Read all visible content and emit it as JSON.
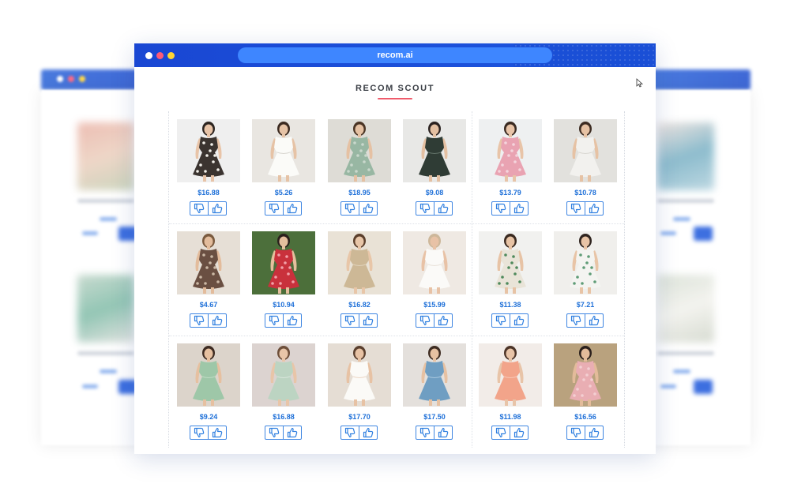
{
  "window": {
    "url": "recom.ai",
    "title": "RECOM SCOUT"
  },
  "products": [
    {
      "price": "$16.88",
      "bg": "#efefef",
      "dress": "#3b3430",
      "skin": "#e8c4a8",
      "hair": "#2c2420",
      "accent": "#f2f0ea",
      "style": "print"
    },
    {
      "price": "$5.26",
      "bg": "#e9e6e1",
      "dress": "#fbfbf8",
      "skin": "#e6c3a6",
      "hair": "#3b2a20",
      "accent": "#d8d6d0",
      "style": "solid"
    },
    {
      "price": "$18.95",
      "bg": "#dedcd6",
      "dress": "#98b7a3",
      "skin": "#e5c1a3",
      "hair": "#4a3424",
      "accent": "#c9d8cc",
      "style": "print"
    },
    {
      "price": "$9.08",
      "bg": "#e8e8e6",
      "dress": "#2f3c35",
      "skin": "#e4c0a2",
      "hair": "#2b2220",
      "accent": "#64746a",
      "style": "solid"
    },
    {
      "price": "$13.79",
      "bg": "#eef0f1",
      "dress": "#e9a3b2",
      "skin": "#e8c4a8",
      "hair": "#3a2a22",
      "accent": "#f4d4dc",
      "style": "print"
    },
    {
      "price": "$10.78",
      "bg": "#e2e1dd",
      "dress": "#f2f1ee",
      "skin": "#e6c2a4",
      "hair": "#3d2c22",
      "accent": "#d9d7d1",
      "style": "solid"
    },
    {
      "price": "$4.67",
      "bg": "#e6dfd6",
      "dress": "#6a4f42",
      "skin": "#e3bc9c",
      "hair": "#7a5a3e",
      "accent": "#cbb8a5",
      "style": "print"
    },
    {
      "price": "$10.94",
      "bg": "#4c6f3b",
      "dress": "#c9313c",
      "skin": "#e5bf9d",
      "hair": "#2a201c",
      "accent": "#f1a0a8",
      "style": "print"
    },
    {
      "price": "$16.82",
      "bg": "#e9e2d6",
      "dress": "#cdb896",
      "skin": "#e8c6a8",
      "hair": "#5b3f2c",
      "accent": "#e0d2ba",
      "style": "solid"
    },
    {
      "price": "$15.99",
      "bg": "#efe9e3",
      "dress": "#fbfaf8",
      "skin": "#e8c2a6",
      "hair": "#cdb79a",
      "accent": "#e9e2da",
      "style": "solid"
    },
    {
      "price": "$11.38",
      "bg": "#f1f1ef",
      "dress": "#e9e4d8",
      "skin": "#e7c3a5",
      "hair": "#3a2a20",
      "accent": "#4f8a5c",
      "style": "print"
    },
    {
      "price": "$7.21",
      "bg": "#f0efec",
      "dress": "#f4f4f1",
      "skin": "#e8c4a6",
      "hair": "#2f241f",
      "accent": "#5f9c77",
      "style": "print"
    },
    {
      "price": "$9.24",
      "bg": "#dcd4cb",
      "dress": "#9ec7a8",
      "skin": "#e6c0a0",
      "hair": "#3d2b22",
      "accent": "#bfdcc4",
      "style": "solid"
    },
    {
      "price": "$16.88",
      "bg": "#dcd3d0",
      "dress": "#bcd4c2",
      "skin": "#e8c5a8",
      "hair": "#6e4f3a",
      "accent": "#d9e6dc",
      "style": "solid"
    },
    {
      "price": "$17.70",
      "bg": "#e5ddd4",
      "dress": "#fbfaf7",
      "skin": "#e7c2a4",
      "hair": "#5a3f2e",
      "accent": "#ecd6c6",
      "style": "solid"
    },
    {
      "price": "$17.50",
      "bg": "#e4e0dc",
      "dress": "#6f9ec2",
      "skin": "#e6c1a2",
      "hair": "#3e2c22",
      "accent": "#a9c8df",
      "style": "solid"
    },
    {
      "price": "$11.98",
      "bg": "#f2ece8",
      "dress": "#f2a48a",
      "skin": "#e8c4a8",
      "hair": "#4c3428",
      "accent": "#f8c7b6",
      "style": "solid"
    },
    {
      "price": "$16.56",
      "bg": "#b9a27e",
      "dress": "#e9aeb3",
      "skin": "#e3bb9a",
      "hair": "#2b201c",
      "accent": "#f3cfd2",
      "style": "print"
    }
  ],
  "colors": {
    "accent": "#1a4fd6",
    "price": "#1d6fd8",
    "underline": "#ef5b6b"
  },
  "icons": {
    "dislike": "thumbs-down-icon",
    "like": "thumbs-up-icon"
  }
}
